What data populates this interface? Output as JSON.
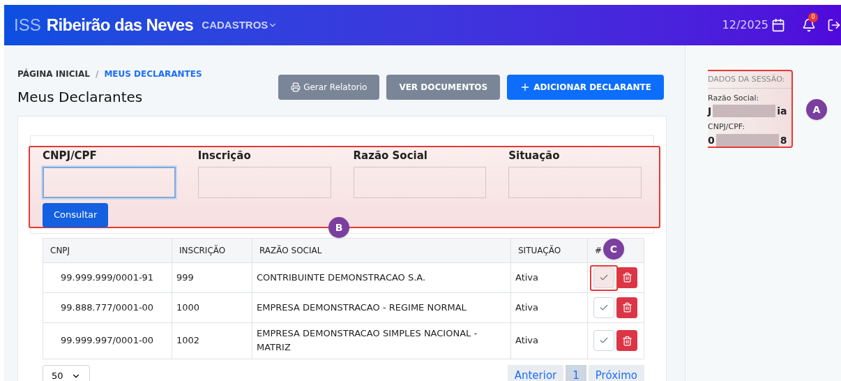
{
  "header": {
    "prefix": "ISS",
    "title": "Ribeirão das Neves",
    "menu": "CADASTROS",
    "period": "12/2025",
    "notifications": "0"
  },
  "breadcrumb_separator": "/",
  "breadcrumb": [
    {
      "label": "PÁGINA INICIAL",
      "selected": false
    },
    {
      "label": "MEUS DECLARANTES",
      "selected": true
    }
  ],
  "page_title": "Meus Declarantes",
  "actions": [
    {
      "label": "Gerar Relatorio",
      "kind": "print"
    },
    {
      "label": "VER DOCUMENTOS",
      "kind": "secondary"
    },
    {
      "label": "ADICIONAR DECLARANTE",
      "kind": "add"
    }
  ],
  "filters": [
    {
      "label": "CNPJ/CPF",
      "focused": true
    },
    {
      "label": "Inscrição",
      "focused": false
    },
    {
      "label": "Razão Social",
      "focused": false
    },
    {
      "label": "Situação",
      "focused": false
    }
  ],
  "search_button": "Consultar",
  "table": {
    "columns": [
      "CNPJ",
      "INSCRIÇÃO",
      "RAZÃO SOCIAL",
      "SITUAÇÃO",
      "#"
    ],
    "rows": [
      {
        "cells": [
          "99.999.999/0001-91",
          "999",
          "CONTRIBUINTE DEMONSTRACAO S.A.",
          "Ativa"
        ],
        "highlighted": true
      },
      {
        "cells": [
          "99.888.777/0001-00",
          "1000",
          "EMPRESA DEMONSTRACAO - REGIME NORMAL",
          "Ativa"
        ],
        "highlighted": false
      },
      {
        "cells": [
          "99.999.997/0001-00",
          "1002",
          "EMPRESA DEMONSTRACAO SIMPLES NACIONAL - MATRIZ",
          "Ativa"
        ],
        "highlighted": false
      }
    ]
  },
  "page_size": "50",
  "pagination": [
    {
      "label": "Anterior",
      "selected": false
    },
    {
      "label": "1",
      "selected": true
    },
    {
      "label": "Próximo",
      "selected": false
    }
  ],
  "session": {
    "title": "DADOS DA SESSÃO:",
    "fields": [
      {
        "label": "Razão Social:",
        "start": "J",
        "end": "ia"
      },
      {
        "label": "CNPJ/CPF:",
        "start": "0",
        "end": "8"
      }
    ]
  },
  "markers": [
    "A",
    "B",
    "C"
  ]
}
